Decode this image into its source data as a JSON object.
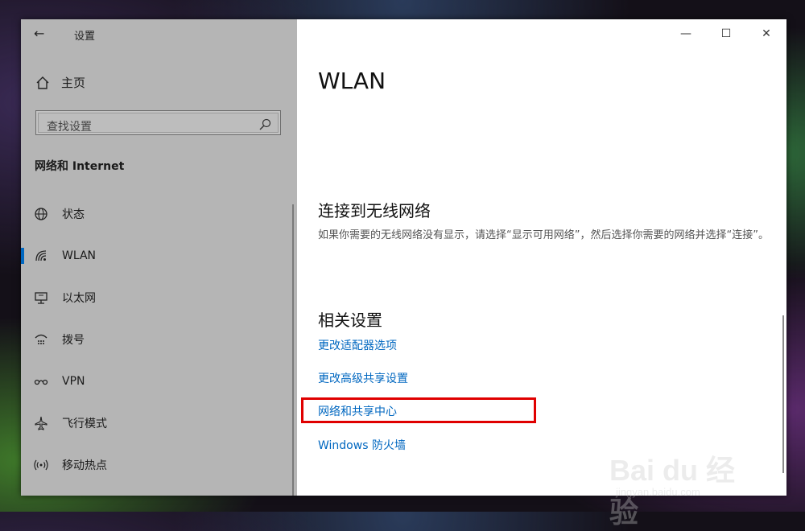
{
  "window": {
    "app_title": "设置",
    "controls": {
      "minimize": "—",
      "maximize": "☐",
      "close": "✕"
    }
  },
  "sidebar": {
    "home_label": "主页",
    "search_placeholder": "查找设置",
    "section_title": "网络和 Internet",
    "items": [
      {
        "label": "状态",
        "icon": "globe-icon",
        "selected": false
      },
      {
        "label": "WLAN",
        "icon": "wifi-icon",
        "selected": true
      },
      {
        "label": "以太网",
        "icon": "ethernet-icon",
        "selected": false
      },
      {
        "label": "拨号",
        "icon": "dialup-icon",
        "selected": false
      },
      {
        "label": "VPN",
        "icon": "vpn-icon",
        "selected": false
      },
      {
        "label": "飞行模式",
        "icon": "airplane-icon",
        "selected": false
      },
      {
        "label": "移动热点",
        "icon": "hotspot-icon",
        "selected": false
      }
    ]
  },
  "main": {
    "page_title": "WLAN",
    "connect_heading": "连接到无线网络",
    "connect_desc": "如果你需要的无线网络没有显示，请选择“显示可用网络”，然后选择你需要的网络并选择“连接”。",
    "related_heading": "相关设置",
    "links": [
      "更改适配器选项",
      "更改高级共享设置",
      "网络和共享中心",
      "Windows 防火墙"
    ]
  },
  "watermark": {
    "brand": "Bai du 经验",
    "url": "jingyan.baidu.com"
  },
  "colors": {
    "accent": "#0067c0",
    "highlight": "#e00000",
    "sidebar_bg": "#b5b5b5"
  }
}
